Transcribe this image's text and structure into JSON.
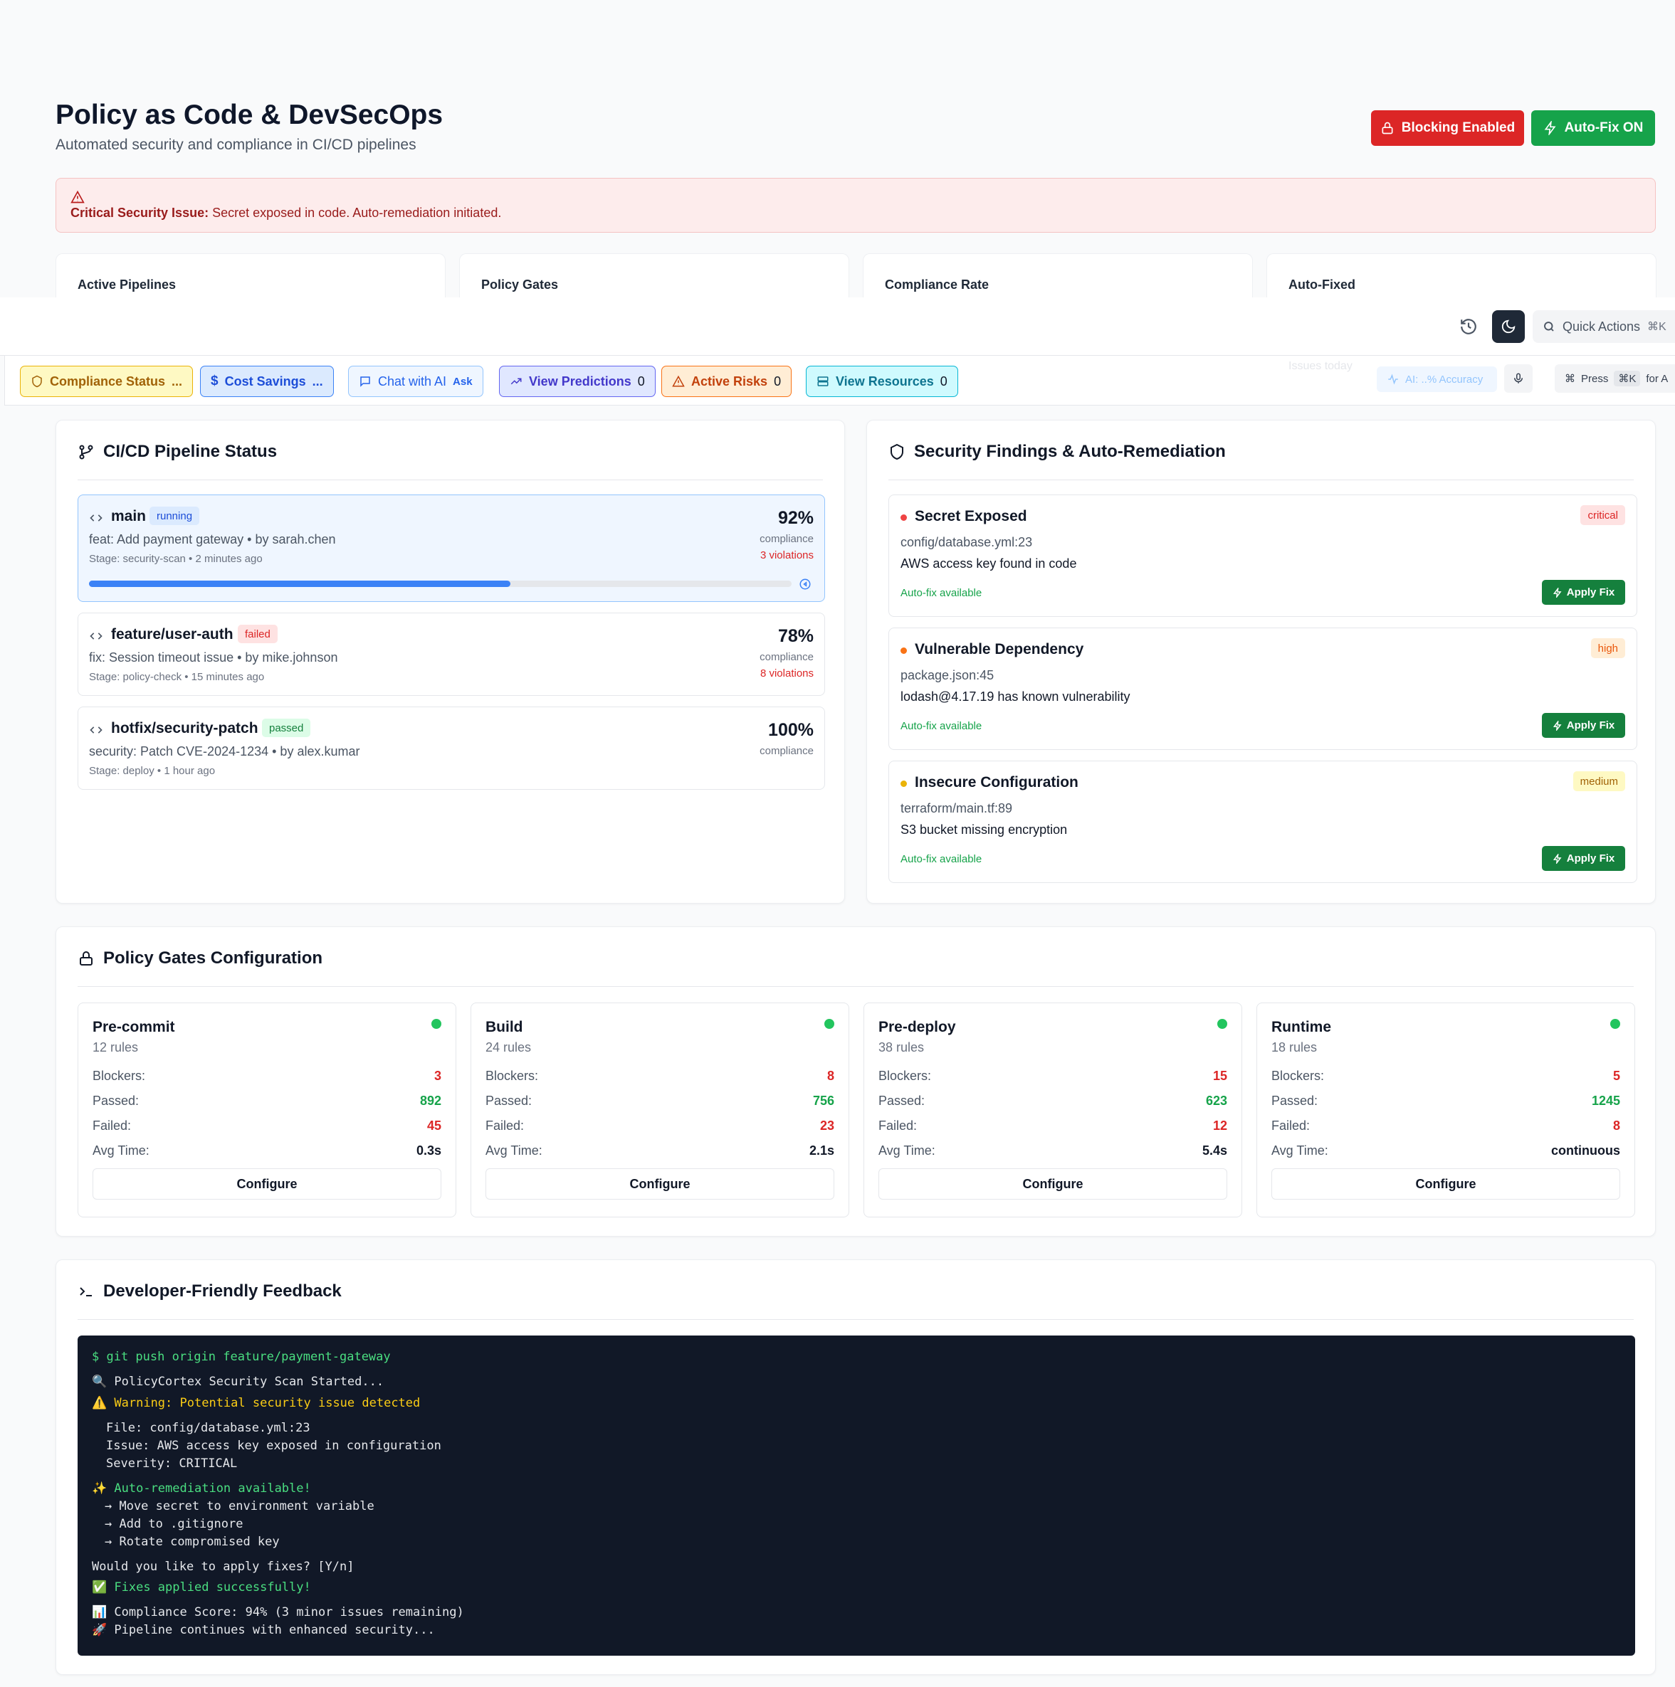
{
  "header": {
    "title": "Policy as Code & DevSecOps",
    "subtitle": "Automated security and compliance in CI/CD pipelines",
    "blocking_label": "Blocking Enabled",
    "autofix_label": "Auto-Fix ON"
  },
  "alert": {
    "bold": "Critical Security Issue:",
    "text": " Secret exposed in code. Auto-remediation initiated."
  },
  "stats": [
    "Active Pipelines",
    "Policy Gates",
    "Compliance Rate",
    "Auto-Fixed"
  ],
  "topbar": {
    "search_label": "Quick Actions",
    "search_kbd": "⌘K",
    "ghost_text": "Issues today",
    "ai_accuracy": "AI: ..% Accuracy",
    "press": "Press",
    "press_kbd": "⌘K",
    "press_for": "for A"
  },
  "chips": {
    "compliance": "Compliance Status",
    "compliance_suffix": "...",
    "cost": "Cost Savings",
    "cost_suffix": "...",
    "chat": "Chat with AI",
    "chat_suffix": "Ask",
    "predictions": "View Predictions",
    "predictions_count": "0",
    "risks": "Active Risks",
    "risks_count": "0",
    "resources": "View Resources",
    "resources_count": "0"
  },
  "pipeline": {
    "title": "CI/CD Pipeline Status",
    "items": [
      {
        "branch": "main",
        "status": "running",
        "message": "feat: Add payment gateway • by sarah.chen",
        "stage": "Stage: security-scan • 2 minutes ago",
        "percent": "92%",
        "label": "compliance",
        "violations": "3 violations",
        "progress": 0.6
      },
      {
        "branch": "feature/user-auth",
        "status": "failed",
        "message": "fix: Session timeout issue • by mike.johnson",
        "stage": "Stage: policy-check • 15 minutes ago",
        "percent": "78%",
        "label": "compliance",
        "violations": "8 violations"
      },
      {
        "branch": "hotfix/security-patch",
        "status": "passed",
        "message": "security: Patch CVE-2024-1234 • by alex.kumar",
        "stage": "Stage: deploy • 1 hour ago",
        "percent": "100%",
        "label": "compliance"
      }
    ]
  },
  "findings": {
    "title": "Security Findings & Auto-Remediation",
    "items": [
      {
        "title": "Secret Exposed",
        "location": "config/database.yml:23",
        "description": "AWS access key found in code",
        "severity": "critical",
        "auto": "Auto-fix available",
        "fix": "Apply Fix"
      },
      {
        "title": "Vulnerable Dependency",
        "location": "package.json:45",
        "description": "lodash@4.17.19 has known vulnerability",
        "severity": "high",
        "auto": "Auto-fix available",
        "fix": "Apply Fix"
      },
      {
        "title": "Insecure Configuration",
        "location": "terraform/main.tf:89",
        "description": "S3 bucket missing encryption",
        "severity": "medium",
        "auto": "Auto-fix available",
        "fix": "Apply Fix"
      }
    ]
  },
  "gates": {
    "title": "Policy Gates Configuration",
    "labels": {
      "blockers": "Blockers:",
      "passed": "Passed:",
      "failed": "Failed:",
      "avg": "Avg Time:",
      "configure": "Configure"
    },
    "items": [
      {
        "name": "Pre-commit",
        "rules": "12 rules",
        "blockers": "3",
        "passed": "892",
        "failed": "45",
        "avg": "0.3s"
      },
      {
        "name": "Build",
        "rules": "24 rules",
        "blockers": "8",
        "passed": "756",
        "failed": "23",
        "avg": "2.1s"
      },
      {
        "name": "Pre-deploy",
        "rules": "38 rules",
        "blockers": "15",
        "passed": "623",
        "failed": "12",
        "avg": "5.4s"
      },
      {
        "name": "Runtime",
        "rules": "18 rules",
        "blockers": "5",
        "passed": "1245",
        "failed": "8",
        "avg": "continuous"
      }
    ]
  },
  "feedback": {
    "title": "Developer-Friendly Feedback",
    "lines": [
      "$ git push origin feature/payment-gateway",
      "🔍 PolicyCortex Security Scan Started...",
      "⚠️ Warning: Potential security issue detected",
      "File: config/database.yml:23",
      "Issue: AWS access key exposed in configuration",
      "Severity: CRITICAL",
      "✨ Auto-remediation available!",
      "→ Move secret to environment variable",
      "→ Add to .gitignore",
      "→ Rotate compromised key",
      "Would you like to apply fixes? [Y/n]",
      "✅ Fixes applied successfully!",
      "📊 Compliance Score: 94% (3 minor issues remaining)",
      "🚀 Pipeline continues with enhanced security..."
    ]
  },
  "colors": {
    "blocking": "#dc2626",
    "autofix": "#16a34a",
    "terminal_bg": "#111827",
    "green_text": "#4ade80",
    "yellow_text": "#facc15"
  }
}
